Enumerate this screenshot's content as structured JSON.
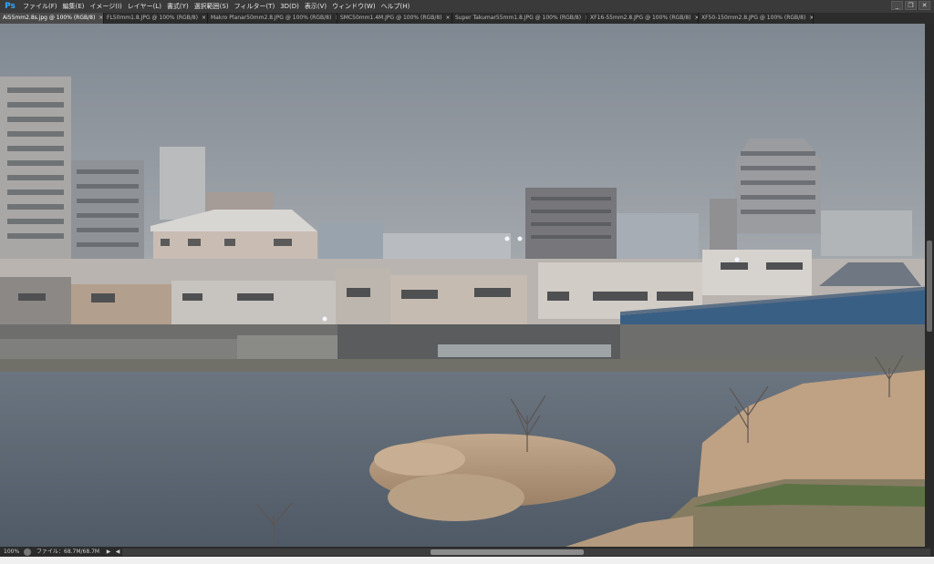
{
  "app": {
    "logo": "Ps"
  },
  "menu": [
    "ファイル(F)",
    "編集(E)",
    "イメージ(I)",
    "レイヤー(L)",
    "書式(Y)",
    "選択範囲(S)",
    "フィルター(T)",
    "3D(D)",
    "表示(V)",
    "ウィンドウ(W)",
    "ヘルプ(H)"
  ],
  "window_controls": {
    "minimize": "_",
    "restore": "❐",
    "close": "✕"
  },
  "tabs": [
    {
      "label": "Ai55mm2.8s.jpg @ 100% (RGB/8)",
      "active": true
    },
    {
      "label": "FL50mm1.8.JPG @ 100% (RGB/8)",
      "active": false
    },
    {
      "label": "Makro Planar50mm2.8.JPG @ 100% (RGB/8)",
      "active": false
    },
    {
      "label": "SMC50mm1.4M.JPG @ 100% (RGB/8)",
      "active": false
    },
    {
      "label": "Super Takumar55mm1.8.JPG @ 100% (RGB/8)",
      "active": false
    },
    {
      "label": "XF16-55mm2.8.JPG @ 100% (RGB/8)",
      "active": false
    },
    {
      "label": "XF50-150mm2.8.JPG @ 100% (RGB/8)",
      "active": false
    }
  ],
  "tab_close_glyph": "×",
  "status": {
    "zoom": "100%",
    "doc_size": "ファイル：68.7M/68.7M",
    "arrow_right": "▶",
    "arrow_left": "◀"
  },
  "colors": {
    "sky": "#8a939c",
    "river": "#5f6a75",
    "reeds": "#b59a7c",
    "bridge": "#3a5f85",
    "ps_blue": "#31a8ff"
  }
}
